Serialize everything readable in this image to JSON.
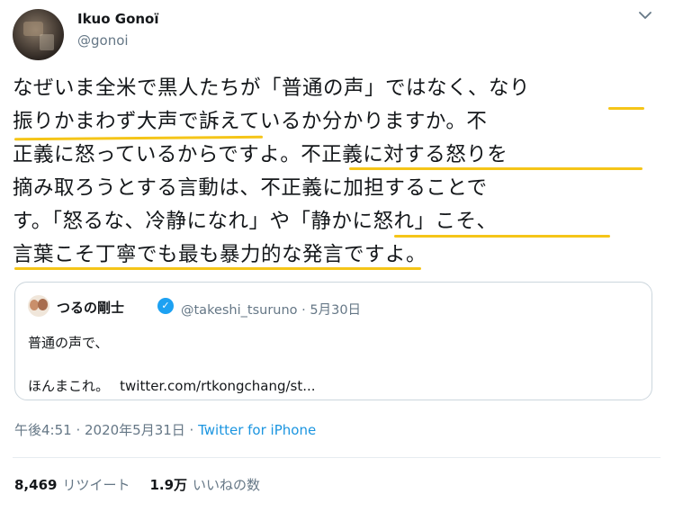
{
  "author": {
    "display_name": "Ikuo Gonoï",
    "handle": "@gonoi"
  },
  "more_icon": "chevron-down-icon",
  "tweet": {
    "lines": [
      "なぜいま全米で黒人たちが「普通の声」ではなく、なり",
      "振りかまわず大声で訴えているか分かりますか。不",
      "正義に怒っているからですよ。不正義に対する怒りを",
      "摘み取ろうとする言動は、不正義に加担することで",
      "す。「怒るな、冷静になれ」や「静かに怒れ」こそ、",
      "言葉こそ丁寧でも最も暴力的な発言ですよ。"
    ],
    "highlight_color": "#f5c518"
  },
  "quoted_tweet": {
    "display_name": "つるの剛士",
    "handle_date": "@takeshi_tsuruno · 5月30日",
    "line1": "普通の声で、",
    "line2": "ほんまこれ。",
    "link": "twitter.com/rtkongchang/st..."
  },
  "meta": {
    "time_date": "午後4:51 · 2020年5月31日 · ",
    "source": "Twitter for iPhone"
  },
  "stats": {
    "retweets_count": "8,469",
    "retweets_label": "リツイート",
    "likes_count": "1.9万",
    "likes_label": "いいねの数"
  },
  "colors": {
    "link": "#1b95e0",
    "secondary_text": "#657786",
    "verified": "#1da1f2"
  }
}
